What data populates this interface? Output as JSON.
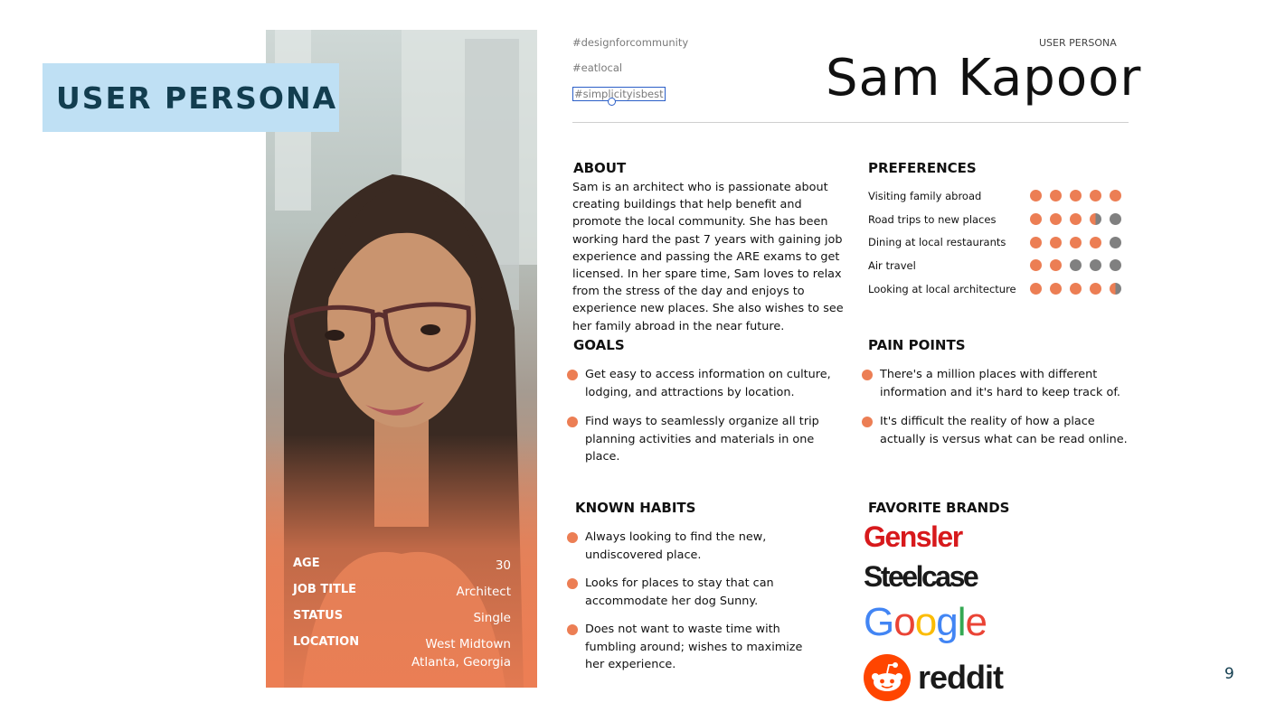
{
  "banner": {
    "label": "USER PERSONA"
  },
  "profile": {
    "stats": [
      {
        "key": "AGE",
        "value": [
          "30"
        ]
      },
      {
        "key": "JOB TITLE",
        "value": [
          "Architect"
        ]
      },
      {
        "key": "STATUS",
        "value": [
          "Single"
        ]
      },
      {
        "key": "LOCATION",
        "value": [
          "West Midtown",
          "Atlanta, Georgia"
        ]
      }
    ]
  },
  "header": {
    "tags": [
      "#designforcommunity",
      "#eatlocal",
      "#simplicityisbest"
    ],
    "kicker": "USER PERSONA",
    "name": "Sam Kapoor"
  },
  "about": {
    "title": "ABOUT",
    "text": "Sam is an architect who is passionate about creating buildings that help benefit and promote the local community. She has been working hard the past 7 years with gaining job experience and passing the ARE exams to get licensed. In her spare time, Sam loves to relax from the stress of the day and enjoys to experience new places. She also wishes to see her family abroad in the near future."
  },
  "preferences": {
    "title": "PREFERENCES",
    "scale_max": 5,
    "items": [
      {
        "label": "Visiting family abroad",
        "rating": 5
      },
      {
        "label": "Road trips to new places",
        "rating": 3.5
      },
      {
        "label": "Dining at local restaurants",
        "rating": 4
      },
      {
        "label": "Air travel",
        "rating": 2
      },
      {
        "label": "Looking at local architecture",
        "rating": 4.5
      }
    ]
  },
  "goals": {
    "title": "GOALS",
    "items": [
      "Get easy to access information on culture, lodging, and attractions by location.",
      "Find ways to seamlessly organize all trip planning activities and materials in one place."
    ]
  },
  "pain_points": {
    "title": "PAIN POINTS",
    "items": [
      "There's a million places with different information and it's hard to keep track of.",
      "It's difficult the reality of how a place actually is versus what can be read online."
    ]
  },
  "habits": {
    "title": "KNOWN HABITS",
    "items": [
      "Always looking to find the new, undiscovered place.",
      "Looks for places to stay that can accommodate her dog Sunny.",
      "Does not want to waste time with fumbling around; wishes to maximize her experience."
    ]
  },
  "brands": {
    "title": "FAVORITE BRANDS",
    "gensler": "Gensler",
    "steelcase": "Steelcase",
    "google": [
      "G",
      "o",
      "o",
      "g",
      "l",
      "e"
    ],
    "reddit": "reddit"
  },
  "colors": {
    "accent": "#ec7e54",
    "inactive_dot": "#808080",
    "banner_bg": "#bfe0f4",
    "banner_text": "#123d4f",
    "google": [
      "#4285F4",
      "#EA4335",
      "#FBBC05",
      "#4285F4",
      "#34A853",
      "#EA4335"
    ]
  },
  "slide": {
    "page_number": "9"
  }
}
